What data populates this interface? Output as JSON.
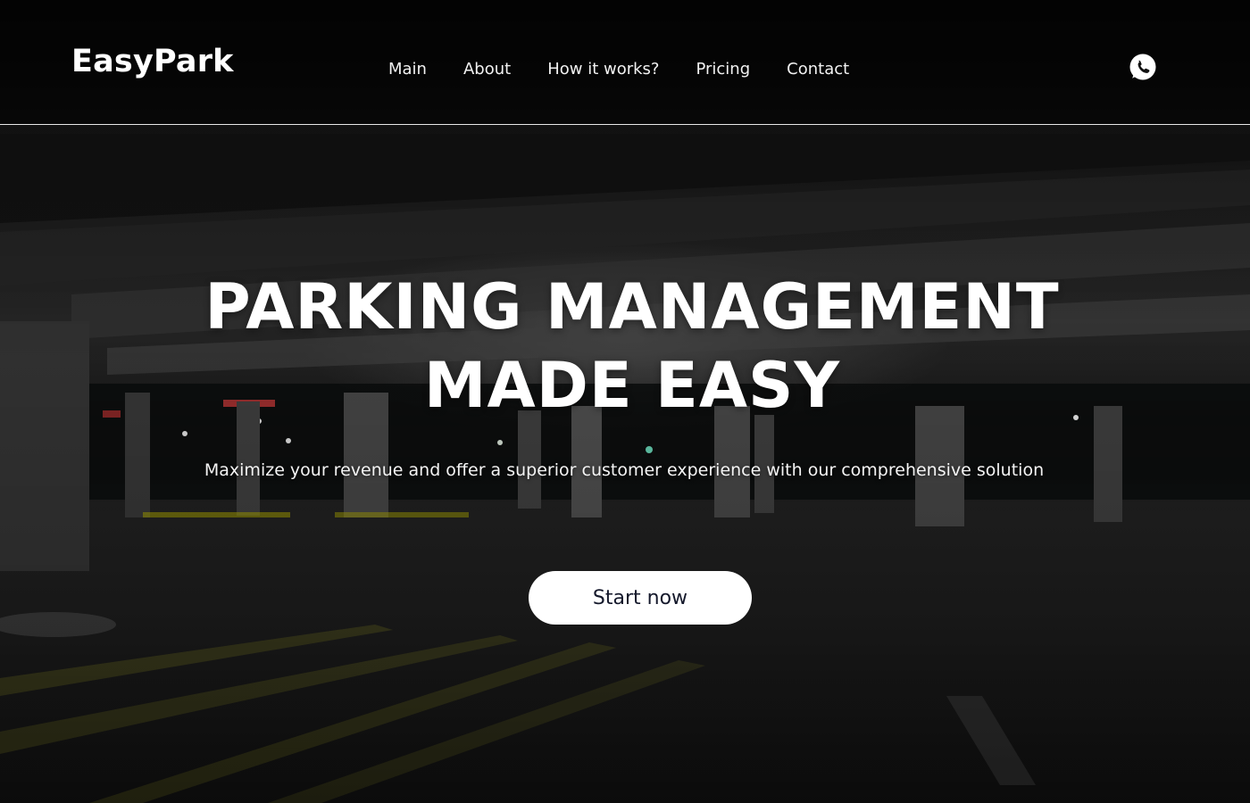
{
  "header": {
    "logo": "EasyPark",
    "nav": [
      {
        "label": "Main"
      },
      {
        "label": "About"
      },
      {
        "label": "How it works?"
      },
      {
        "label": "Pricing"
      },
      {
        "label": "Contact"
      }
    ],
    "social_icon": "whatsapp-icon"
  },
  "hero": {
    "title_line1": "PARKING MANAGEMENT",
    "title_line2": "MADE EASY",
    "subtitle": "Maximize your revenue and offer a superior customer experience with our comprehensive solution",
    "cta_label": "Start now"
  },
  "colors": {
    "cta_background": "#ffffff",
    "cta_text": "#14182b",
    "header_border": "#e8e8e8"
  }
}
